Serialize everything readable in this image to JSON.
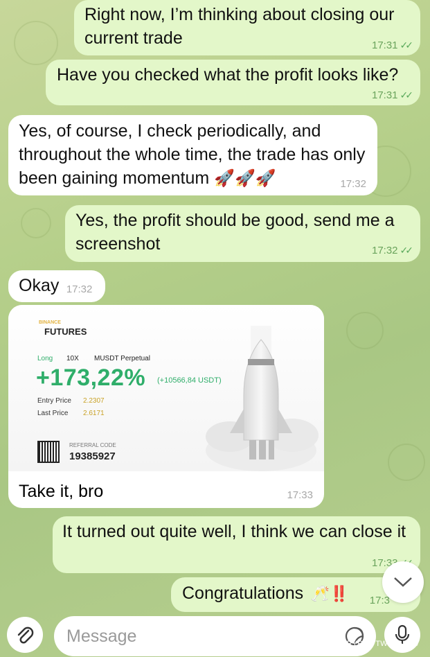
{
  "messages": [
    {
      "text": "Right now, I’m thinking about closing our current trade",
      "time": "17:31"
    },
    {
      "text": "Have you checked what the profit looks like?",
      "time": "17:31"
    },
    {
      "text": "Yes, of course, I check periodically, and throughout the whole time, the trade has only been gaining momentum",
      "emoji": "🚀🚀🚀",
      "time": "17:32"
    },
    {
      "text": "Yes, the profit should be good, send me a screenshot",
      "time": "17:32"
    },
    {
      "text": "Okay",
      "time": "17:32"
    },
    {
      "text": "Take it, bro",
      "time": "17:33"
    },
    {
      "text": "It turned out quite well, I think we can close it",
      "time": "17:33"
    },
    {
      "text": "Congratulations",
      "emoji": "🥂‼️",
      "time": "17:3"
    }
  ],
  "card": {
    "brand_small": "BINANCE",
    "brand": "FUTURES",
    "side": "Long",
    "leverage": "10X",
    "pair": "MUSDT Perpetual",
    "pnl_pct": "+173,22%",
    "pnl_usdt": "(+10566,84 USDT)",
    "entry_label": "Entry Price",
    "entry_value": "2.2307",
    "last_label": "Last Price",
    "last_value": "2.6171",
    "ref_label": "REFERRAL CODE",
    "ref_code": "19385927"
  },
  "composer": {
    "placeholder": "Message",
    "attach_icon": "paperclip-icon",
    "sticker_icon": "sticker-icon",
    "mic_icon": "microphone-icon",
    "scroll_icon": "chevron-down-icon"
  },
  "watermark": "@ CRYPTO TWILIGHTS",
  "colors": {
    "outgoing": "#e3f7c9",
    "incoming": "#ffffff",
    "green": "#2fae6a"
  }
}
